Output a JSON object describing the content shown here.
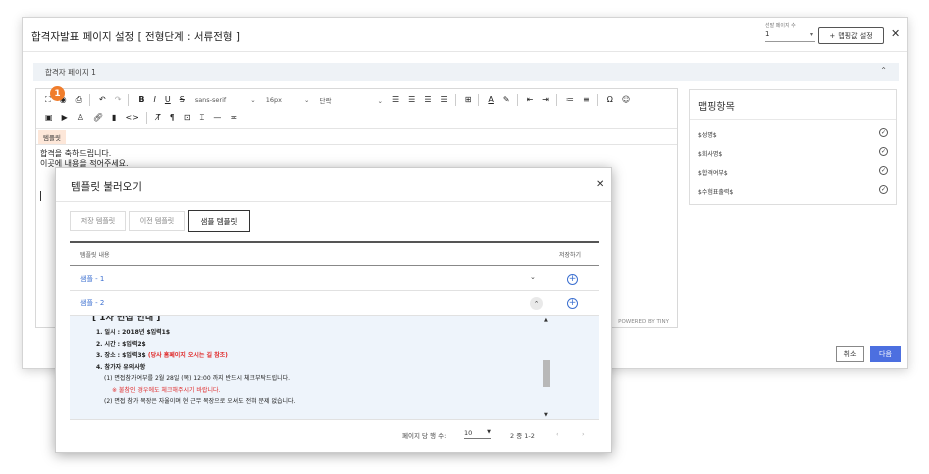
{
  "outer": {
    "title": "합격자발표 페이지 설정 [ 전형단계 : 서류전형 ]",
    "pages_label": "선발 페이지 수",
    "pages_value": "1",
    "mapping_button": "맵핑값 설정",
    "section_label": "합격자 페이지 1"
  },
  "editor": {
    "font_family": "sans-serif",
    "font_size": "16px",
    "block_format": "단락",
    "template_tab": "템플릿",
    "content_line1": "합격을 축하드립니다.",
    "content_line2": "이곳에 내용을 적어주세요.",
    "powered_by": "POWERED BY TINY",
    "badge_number": "1"
  },
  "mapping_panel": {
    "title": "맵핑항목",
    "items": [
      "$성명$",
      "$회사명$",
      "$합격여부$",
      "$수험표출력$"
    ]
  },
  "footer": {
    "cancel": "취소",
    "next": "다음"
  },
  "modal": {
    "title": "템플릿 불러오기",
    "tabs": [
      "저장 템플릿",
      "이전 템플릿",
      "샘플 템플릿"
    ],
    "active_tab": 2,
    "col_content": "템플릿 내용",
    "col_save": "저장하기",
    "rows": [
      {
        "label": "샘플 - 1"
      },
      {
        "label": "샘플 - 2"
      }
    ],
    "preview": {
      "heading": "[ 1차 면접 안내 ]",
      "line1": "1. 일시 : 2018년 $입력1$",
      "line2": "2. 시간 : $입력2$",
      "line3_prefix": "3. 장소 : $입력3$ ",
      "line3_red": "(당사 홈페이지 오시는 길 참조)",
      "line4": "4. 참가자 유의사항",
      "line5": "(1) 면접참가여부를 2월 28일 (목) 12:00 까지 반드시 체크부탁드립니다.",
      "line6": "※ 불참인 경우에도 체크해주시기 바랍니다.",
      "line7": "(2) 면접 참가 복장은 자율이며 현 근무 복장으로 오셔도 전혀 문제 없습니다."
    },
    "pager": {
      "rows_label": "페이지 당 행 수:",
      "rows_value": "10",
      "range": "2 중 1-2"
    }
  }
}
